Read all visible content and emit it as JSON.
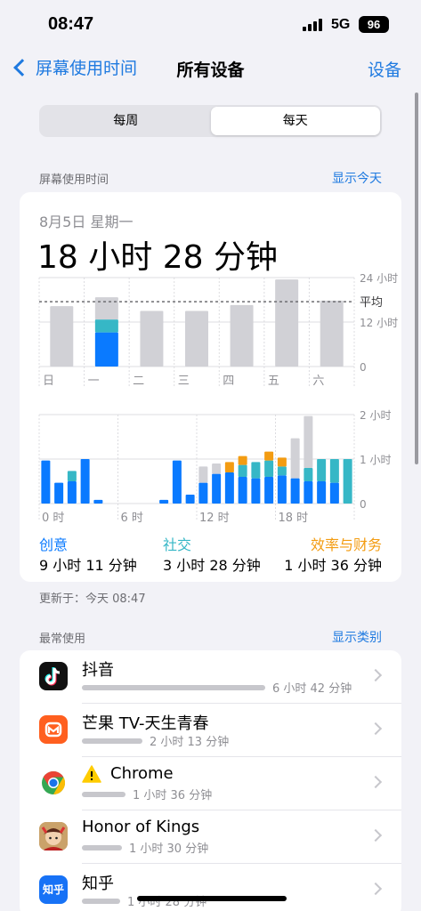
{
  "status": {
    "time": "08:47",
    "network": "5G",
    "battery": "96"
  },
  "nav": {
    "back_label": "屏幕使用时间",
    "title": "所有设备",
    "right_label": "设备"
  },
  "segmented": {
    "options": [
      "每周",
      "每天"
    ],
    "selected": "每天"
  },
  "screen_time_section": {
    "header": "屏幕使用时间",
    "link": "显示今天"
  },
  "summary": {
    "date": "8月5日 星期一",
    "total": "18 小时 28 分钟"
  },
  "colors": {
    "creative": "#0a7aff",
    "social": "#36b7c6",
    "productivity": "#f39c12",
    "other": "#d1d1d6",
    "accent": "#1f7ae0"
  },
  "chart_data": [
    {
      "type": "bar",
      "categories": [
        "日",
        "一",
        "二",
        "三",
        "四",
        "五",
        "六"
      ],
      "series": [
        {
          "name": "创意",
          "values": [
            0,
            9.2,
            0,
            0,
            0,
            0,
            0
          ]
        },
        {
          "name": "社交",
          "values": [
            0,
            3.5,
            0,
            0,
            0,
            0,
            0
          ]
        },
        {
          "name": "效率与财务",
          "values": [
            0,
            0,
            0,
            0,
            0,
            0,
            0
          ]
        },
        {
          "values": [
            16.3,
            6.0,
            15.0,
            15.0,
            16.6,
            23.5,
            17.8
          ]
        }
      ],
      "yticks": [
        "24 小时",
        "12 小时",
        "0"
      ],
      "ylim": [
        0,
        24
      ],
      "reference_line": {
        "label": "平均",
        "value": 17.5
      },
      "grid": true
    },
    {
      "type": "bar",
      "categories": [
        "0",
        "1",
        "2",
        "3",
        "4",
        "5",
        "6",
        "7",
        "8",
        "9",
        "10",
        "11",
        "12",
        "13",
        "14",
        "15",
        "16",
        "17",
        "18",
        "19",
        "20",
        "21",
        "22",
        "23"
      ],
      "xticks": [
        "0 时",
        "6 时",
        "12 时",
        "18 时"
      ],
      "series": [
        {
          "name": "创意",
          "values": [
            58,
            28,
            30,
            60,
            5,
            0,
            0,
            0,
            0,
            5,
            58,
            12,
            28,
            40,
            42,
            36,
            34,
            36,
            38,
            34,
            30,
            30,
            28,
            0
          ]
        },
        {
          "name": "社交",
          "values": [
            0,
            0,
            14,
            0,
            0,
            0,
            0,
            0,
            0,
            0,
            0,
            0,
            0,
            0,
            0,
            16,
            22,
            22,
            12,
            0,
            18,
            30,
            32,
            60
          ]
        },
        {
          "name": "效率与财务",
          "values": [
            0,
            0,
            0,
            0,
            0,
            0,
            0,
            0,
            0,
            0,
            0,
            0,
            0,
            0,
            14,
            12,
            0,
            12,
            12,
            0,
            0,
            0,
            0,
            0
          ]
        },
        {
          "values": [
            0,
            0,
            0,
            0,
            0,
            0,
            0,
            0,
            0,
            0,
            0,
            0,
            22,
            14,
            0,
            0,
            0,
            0,
            0,
            54,
            70,
            0,
            0,
            0
          ]
        }
      ],
      "yticks": [
        "2 小时",
        "1 小时",
        "0"
      ],
      "ylim": [
        0,
        120
      ],
      "grid": true
    }
  ],
  "legend": [
    {
      "name": "创意",
      "value": "9 小时 11 分钟"
    },
    {
      "name": "社交",
      "value": "3 小时 28 分钟"
    },
    {
      "name": "效率与财务",
      "value": "1 小时 36 分钟"
    }
  ],
  "updated": "更新于：今天 08:47",
  "most_used_section": {
    "header": "最常使用",
    "link": "显示类别"
  },
  "apps": [
    {
      "name": "抖音",
      "time": "6 小时 42 分钟",
      "icon": "douyin-icon",
      "fraction": 1.0
    },
    {
      "name": "芒果 TV-天生青春",
      "time": "2 小时 13 分钟",
      "icon": "mango-tv-icon",
      "fraction": 0.33
    },
    {
      "name": "Chrome",
      "time": "1 小时 36 分钟",
      "icon": "chrome-icon",
      "fraction": 0.24
    },
    {
      "name": "Honor of Kings",
      "time": "1 小时 30 分钟",
      "icon": "honor-of-kings-icon",
      "fraction": 0.22
    },
    {
      "name": "知乎",
      "time": "1 小时 28 分钟",
      "icon": "zhihu-icon",
      "icon_text": "知乎",
      "fraction": 0.21
    }
  ]
}
